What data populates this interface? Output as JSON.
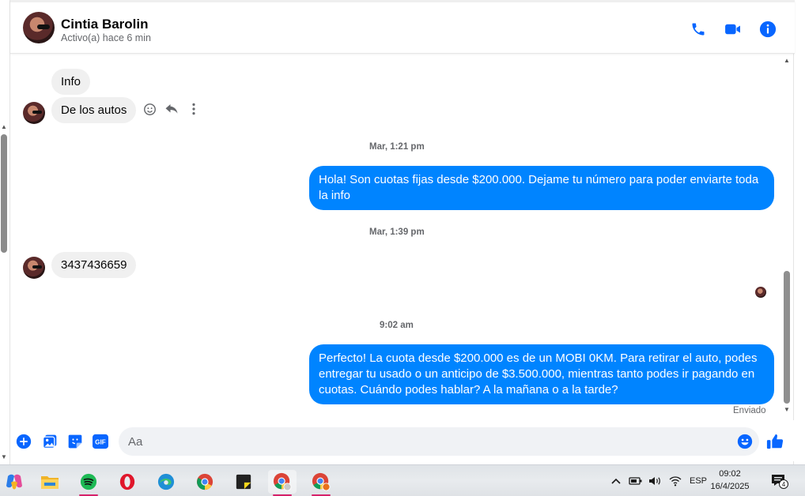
{
  "header": {
    "contact_name": "Cintia Barolin",
    "status": "Activo(a) hace 6 min"
  },
  "messages": {
    "in_info": "Info",
    "in_autos": "De los autos",
    "ts_1": "Mar, 1:21 pm",
    "out_1": "Hola! Son cuotas fijas desde $200.000. Dejame tu número para poder enviarte toda la info",
    "ts_2": "Mar, 1:39 pm",
    "in_number": "3437436659",
    "ts_3": "9:02 am",
    "out_2": "Perfecto! La cuota desde $200.000 es de un MOBI 0KM. Para retirar el auto, podes entregar tu usado o un anticipo de $3.500.000, mientras tanto podes ir pagando en cuotas. Cuándo podes hablar? A la mañana o a la tarde?",
    "sent_status": "Enviado"
  },
  "composer": {
    "placeholder": "Aa",
    "gif_label": "GIF"
  },
  "taskbar": {
    "time": "09:02",
    "date": "16/4/2025",
    "language": "ESP",
    "notification_count": "4"
  },
  "colors": {
    "accent": "#0084ff",
    "incoming_bubble": "#f0f0f0",
    "icon_blue": "#0866ff"
  }
}
